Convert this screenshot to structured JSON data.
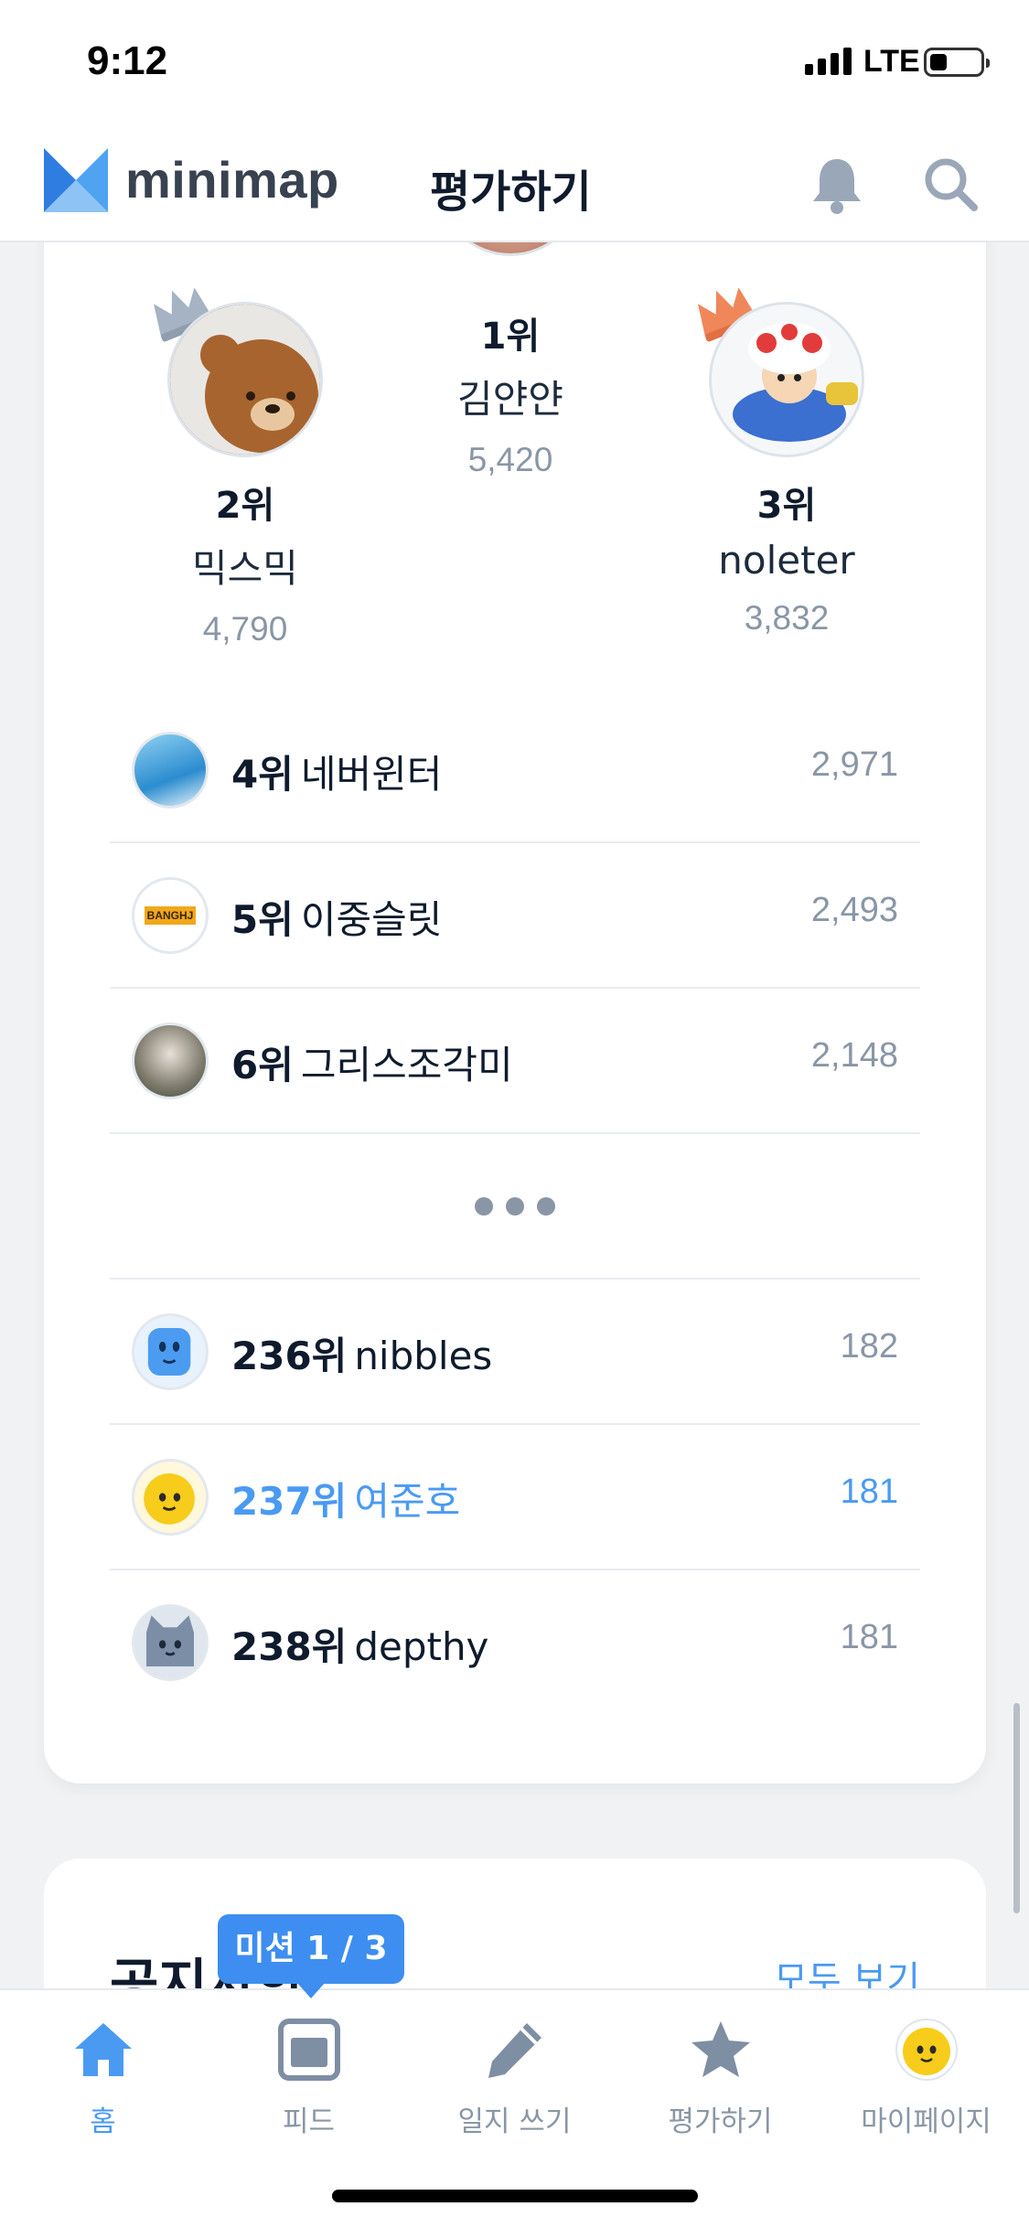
{
  "status_bar": {
    "time": "9:12",
    "network": "LTE"
  },
  "header": {
    "brand": "minimap",
    "title": "평가하기"
  },
  "podium": [
    {
      "rank_label": "1위",
      "name": "김얀얀",
      "score": "5,420"
    },
    {
      "rank_label": "2위",
      "name": "믹스믹",
      "score": "4,790"
    },
    {
      "rank_label": "3위",
      "name": "noleter",
      "score": "3,832"
    }
  ],
  "ranking_list": [
    {
      "rank_label": "4위",
      "name": "네버윈터",
      "score": "2,971"
    },
    {
      "rank_label": "5위",
      "name": "이중슬릿",
      "score": "2,493",
      "avatar_text": "BANGHJ"
    },
    {
      "rank_label": "6위",
      "name": "그리스조각미",
      "score": "2,148"
    },
    {
      "rank_label": "236위",
      "name": "nibbles",
      "score": "182"
    },
    {
      "rank_label": "237위",
      "name": "여준호",
      "score": "181"
    },
    {
      "rank_label": "238위",
      "name": "depthy",
      "score": "181"
    }
  ],
  "notice": {
    "title": "공지사항",
    "see_all": "모두 보기"
  },
  "mission_badge": "미션 1 / 3",
  "tabs": [
    {
      "label": "홈",
      "icon": "home-icon"
    },
    {
      "label": "피드",
      "icon": "feed-icon"
    },
    {
      "label": "일지 쓰기",
      "icon": "pencil-icon"
    },
    {
      "label": "평가하기",
      "icon": "star-icon"
    },
    {
      "label": "마이페이지",
      "icon": "avatar-icon"
    }
  ],
  "colors": {
    "accent": "#4a9af2",
    "text": "#0f1b2d",
    "muted": "#8a96a6",
    "background": "#f1f2f4"
  }
}
